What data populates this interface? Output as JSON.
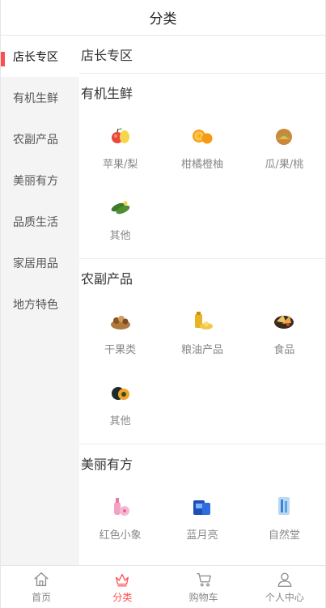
{
  "header": {
    "title": "分类"
  },
  "sidebar": {
    "items": [
      {
        "label": "店长专区",
        "active": true
      },
      {
        "label": "有机生鲜"
      },
      {
        "label": "农副产品"
      },
      {
        "label": "美丽有方"
      },
      {
        "label": "品质生活"
      },
      {
        "label": "家居用品"
      },
      {
        "label": "地方特色"
      }
    ]
  },
  "main": {
    "sections": [
      {
        "title": "店长专区"
      },
      {
        "title": "有机生鲜",
        "items": [
          {
            "label": "苹果/梨"
          },
          {
            "label": "柑橘橙柚"
          },
          {
            "label": "瓜/果/桃"
          },
          {
            "label": "其他"
          }
        ]
      },
      {
        "title": "农副产品",
        "items": [
          {
            "label": "干果类"
          },
          {
            "label": "粮油产品"
          },
          {
            "label": "食品"
          },
          {
            "label": "其他"
          }
        ]
      },
      {
        "title": "美丽有方",
        "items": [
          {
            "label": "红色小象"
          },
          {
            "label": "蓝月亮"
          },
          {
            "label": "自然堂"
          }
        ]
      }
    ]
  },
  "tabbar": {
    "tabs": [
      {
        "label": "首页"
      },
      {
        "label": "分类",
        "active": true
      },
      {
        "label": "购物车"
      },
      {
        "label": "个人中心"
      }
    ]
  },
  "colors": {
    "accent": "#ff4d4f",
    "sidebar_bg": "#f4f4f4"
  }
}
